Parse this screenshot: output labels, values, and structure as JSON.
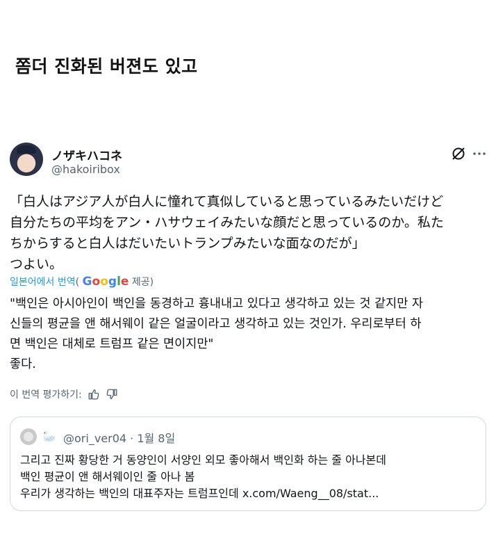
{
  "heading": "쫌더 진화된 버젼도 있고",
  "tweet": {
    "display_name": "ノザキハコネ",
    "handle": "@hakoiribox",
    "original_lines": [
      "「白人はアジア人が白人に憧れて真似していると思っているみたいだけど",
      "自分たちの平均をアン・ハサウェイみたいな顔だと思っているのか。私た",
      "ちからすると白人はだいたいトランプみたいな面なのだが」",
      "つよい。"
    ],
    "translated_from": "일본어에서 번역",
    "translated_by_prefix": "(",
    "translated_by_brand": "Google",
    "translated_by_suffix": " 제공)",
    "translated_lines": [
      "\"백인은 아시아인이 백인을 동경하고 흉내내고 있다고 생각하고 있는 것 같지만 자",
      "신들의 평균을 앤 해서웨이 같은 얼굴이라고 생각하고 있는 것인가. 우리로부터 하",
      "면 백인은 대체로 트럼프 같은 면이지만\"",
      "좋다."
    ],
    "rate_translation": "이 번역 평가하기:"
  },
  "quote": {
    "emoji": "🦢",
    "handle_date": "@ori_ver04 · 1월 8일",
    "lines": [
      "그리고 진짜 황당한 거 동양인이 서양인 외모 좋아해서 백인화 하는 줄 아나본데",
      "백인 평균이 앤 해서웨이인 줄 아나 봄",
      "우리가 생각하는 백인의 대표주자는 트럼프인데 x.com/Waeng__08/stat..."
    ]
  },
  "colors": {
    "secondary_text": "#536471",
    "link": "#1d9bf0",
    "border": "#cfd9de"
  }
}
